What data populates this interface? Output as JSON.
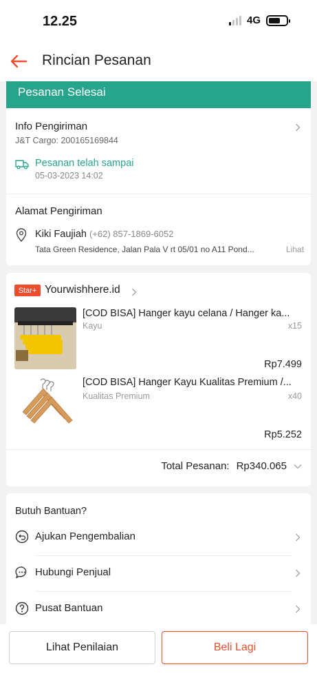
{
  "status_bar": {
    "time": "12.25",
    "network": "4G"
  },
  "header": {
    "title": "Rincian Pesanan"
  },
  "order_status": "Pesanan Selesai",
  "shipping_info": {
    "title": "Info Pengiriman",
    "courier": "J&T Cargo: 200165169844",
    "status": "Pesanan telah sampai",
    "datetime": "05-03-2023 14:02"
  },
  "shipping_address": {
    "title": "Alamat Pengiriman",
    "name": "Kiki Faujiah",
    "phone": "(+62) 857-1869-6052",
    "address": "Tata Green Residence, Jalan Pala V rt 05/01 no A11 Pond...",
    "more": "Lihat"
  },
  "shop": {
    "badge": "Star+",
    "name": "Yourwishhere.id",
    "products": [
      {
        "name": "[COD BISA] Hanger kayu celana / Hanger ka...",
        "variant": "Kayu",
        "qty": "x15",
        "price": "Rp7.499"
      },
      {
        "name": "[COD BISA] Hanger Kayu Kualitas Premium /...",
        "variant": "Kualitas Premium",
        "qty": "x40",
        "price": "Rp5.252"
      }
    ],
    "total_label": "Total Pesanan:",
    "total_value": "Rp340.065"
  },
  "help": {
    "title": "Butuh Bantuan?",
    "items": [
      {
        "label": "Ajukan Pengembalian",
        "icon": "return-icon"
      },
      {
        "label": "Hubungi Penjual",
        "icon": "chat-icon"
      },
      {
        "label": "Pusat Bantuan",
        "icon": "help-circle-icon"
      }
    ]
  },
  "actions": {
    "review": "Lihat Penilaian",
    "rebuy": "Beli Lagi"
  },
  "colors": {
    "accent": "#ee4d2d",
    "success": "#26a58c"
  }
}
